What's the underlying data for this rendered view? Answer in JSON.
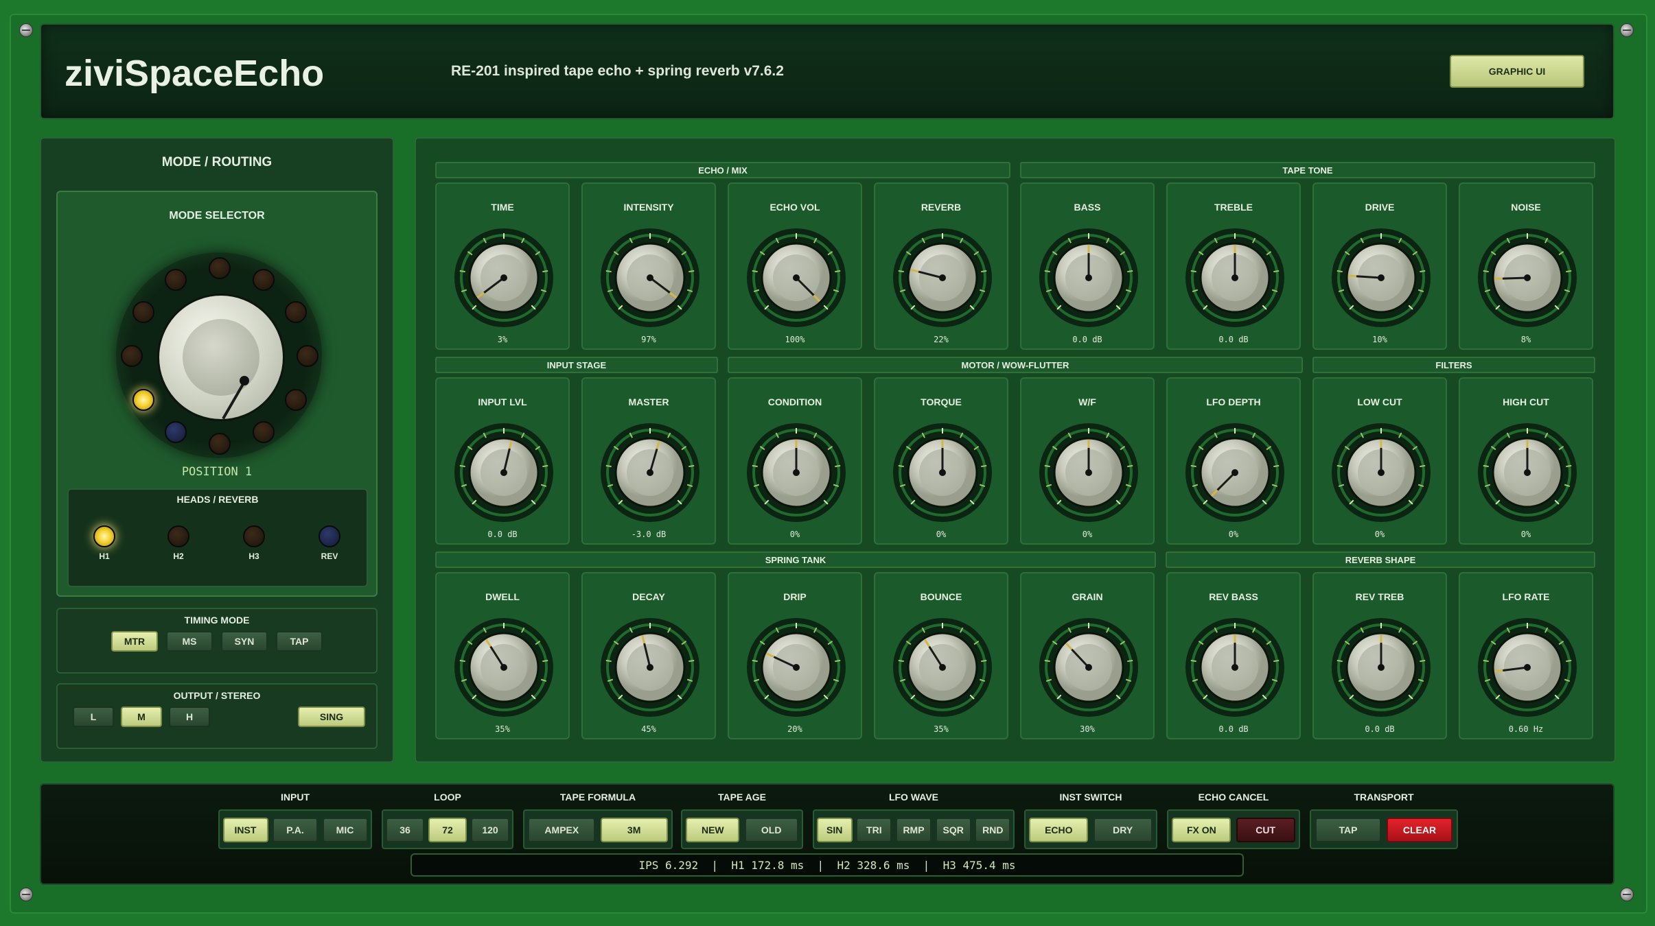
{
  "app": {
    "title": "ziviSpaceEcho",
    "subtitle": "RE-201 inspired tape echo + spring reverb v7.6.2",
    "graphic_ui_button": "GRAPHIC UI"
  },
  "colors": {
    "background": "#1d7a2c",
    "panel": "#154a23",
    "accent_on": "#dfe8a8",
    "lamp": "#f4d230",
    "clear": "#e3222a"
  },
  "left": {
    "title": "MODE / ROUTING",
    "mode_selector": {
      "title": "MODE SELECTOR",
      "position_label": "POSITION 1",
      "selected_position": 1,
      "position_count": 12
    },
    "heads": {
      "title": "HEADS / REVERB",
      "items": [
        {
          "label": "H1",
          "lit": true
        },
        {
          "label": "H2",
          "lit": false
        },
        {
          "label": "H3",
          "lit": false
        },
        {
          "label": "REV",
          "lit": false
        }
      ]
    },
    "timing": {
      "title": "TIMING MODE",
      "buttons": [
        {
          "label": "MTR",
          "active": true
        },
        {
          "label": "MS",
          "active": false
        },
        {
          "label": "SYN",
          "active": false
        },
        {
          "label": "TAP",
          "active": false
        }
      ]
    },
    "output": {
      "title": "OUTPUT / STEREO",
      "buttons": [
        {
          "label": "L",
          "active": false
        },
        {
          "label": "M",
          "active": true
        },
        {
          "label": "H",
          "active": false
        }
      ],
      "sing": {
        "label": "SING",
        "active": true
      }
    }
  },
  "sections": {
    "echo_mix": "ECHO / MIX",
    "tape_tone": "TAPE TONE",
    "input_stage": "INPUT STAGE",
    "motor": "MOTOR / WOW-FLUTTER",
    "filters": "FILTERS",
    "spring_tank": "SPRING TANK",
    "reverb_shape": "REVERB SHAPE"
  },
  "knobs": {
    "row1": [
      {
        "label": "TIME",
        "value": "3%",
        "level": 0.03
      },
      {
        "label": "INTENSITY",
        "value": "97%",
        "level": 0.97
      },
      {
        "label": "ECHO VOL",
        "value": "100%",
        "level": 1.0
      },
      {
        "label": "REVERB",
        "value": "22%",
        "level": 0.22
      },
      {
        "label": "BASS",
        "value": "0.0 dB",
        "level": 0.5
      },
      {
        "label": "TREBLE",
        "value": "0.0 dB",
        "level": 0.5
      },
      {
        "label": "DRIVE",
        "value": "10%",
        "level": 0.18
      },
      {
        "label": "NOISE",
        "value": "8%",
        "level": 0.16
      }
    ],
    "row2": [
      {
        "label": "INPUT LVL",
        "value": "0.0 dB",
        "level": 0.55
      },
      {
        "label": "MASTER",
        "value": "-3.0 dB",
        "level": 0.56
      },
      {
        "label": "CONDITION",
        "value": "0%",
        "level": 0.5
      },
      {
        "label": "TORQUE",
        "value": "0%",
        "level": 0.5
      },
      {
        "label": "W/F",
        "value": "0%",
        "level": 0.5
      },
      {
        "label": "LFO DEPTH",
        "value": "0%",
        "level": 0.0
      },
      {
        "label": "LOW CUT",
        "value": "0%",
        "level": 0.5
      },
      {
        "label": "HIGH CUT",
        "value": "0%",
        "level": 0.5
      }
    ],
    "row3": [
      {
        "label": "DWELL",
        "value": "35%",
        "level": 0.38
      },
      {
        "label": "DECAY",
        "value": "45%",
        "level": 0.45
      },
      {
        "label": "DRIP",
        "value": "20%",
        "level": 0.26
      },
      {
        "label": "BOUNCE",
        "value": "35%",
        "level": 0.38
      },
      {
        "label": "GRAIN",
        "value": "30%",
        "level": 0.34
      },
      {
        "label": "REV BASS",
        "value": "0.0 dB",
        "level": 0.5
      },
      {
        "label": "REV TREB",
        "value": "0.0 dB",
        "level": 0.5
      },
      {
        "label": "LFO RATE",
        "value": "0.60 Hz",
        "level": 0.14
      }
    ]
  },
  "bottom": {
    "groups": [
      {
        "title": "INPUT",
        "buttons": [
          {
            "label": "INST",
            "state": "on"
          },
          {
            "label": "P.A.",
            "state": "off"
          },
          {
            "label": "MIC",
            "state": "off"
          }
        ]
      },
      {
        "title": "LOOP",
        "buttons": [
          {
            "label": "36",
            "state": "off"
          },
          {
            "label": "72",
            "state": "on"
          },
          {
            "label": "120",
            "state": "off"
          }
        ]
      },
      {
        "title": "TAPE FORMULA",
        "buttons": [
          {
            "label": "AMPEX",
            "state": "off"
          },
          {
            "label": "3M",
            "state": "on"
          }
        ]
      },
      {
        "title": "TAPE AGE",
        "buttons": [
          {
            "label": "NEW",
            "state": "on"
          },
          {
            "label": "OLD",
            "state": "off"
          }
        ]
      },
      {
        "title": "LFO WAVE",
        "buttons": [
          {
            "label": "SIN",
            "state": "on"
          },
          {
            "label": "TRI",
            "state": "off"
          },
          {
            "label": "RMP",
            "state": "off"
          },
          {
            "label": "SQR",
            "state": "off"
          },
          {
            "label": "RND",
            "state": "off"
          }
        ]
      },
      {
        "title": "INST SWITCH",
        "buttons": [
          {
            "label": "ECHO",
            "state": "on"
          },
          {
            "label": "DRY",
            "state": "off"
          }
        ]
      },
      {
        "title": "ECHO CANCEL",
        "buttons": [
          {
            "label": "FX ON",
            "state": "on"
          },
          {
            "label": "CUT",
            "state": "dark-red"
          }
        ]
      },
      {
        "title": "TRANSPORT",
        "buttons": [
          {
            "label": "TAP",
            "state": "off"
          },
          {
            "label": "CLEAR",
            "state": "red"
          }
        ]
      }
    ],
    "status": "IPS 6.292  |  H1 172.8 ms  |  H2 328.6 ms  |  H3 475.4 ms"
  }
}
